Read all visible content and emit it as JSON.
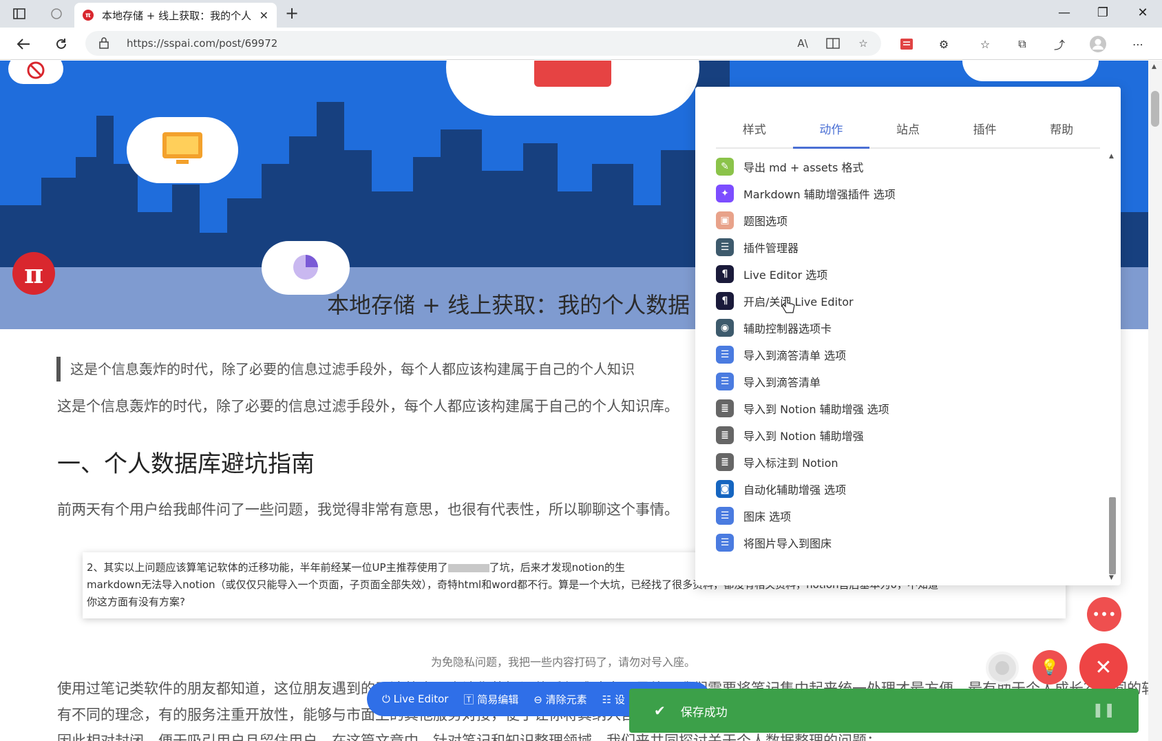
{
  "browser": {
    "tab_title": "本地存储 + 线上获取：我的个人",
    "tab_favicon": "π",
    "url": "https://sspai.com/post/69972"
  },
  "hero": {
    "title": "本地存储 + 线上获取：我的个人数据",
    "logo": "π"
  },
  "article": {
    "quote": "这是个信息轰炸的时代，除了必要的信息过滤手段外，每个人都应该构建属于自己的个人知识",
    "intro": "这是个信息轰炸的时代，除了必要的信息过滤手段外，每个人都应该构建属于自己的个人知识库。",
    "heading": "一、个人数据库避坑指南",
    "paragraph1": "前两天有个用户给我邮件问了一些问题，我觉得非常有意思，也很有代表性，所以聊聊这个事情。",
    "email_line1_a": "2、其实以上问题应该算笔记软体的迁移功能，半年前经某一位UP主推荐使用了",
    "email_line1_b": "了坑，后来才发现notion的生",
    "email_line2": "markdown无法导入notion（或仅仅只能导入一个页面，子页面全部失效），奇特html和word都不行。算是一个大坑，已经找了很多资料，都没有相关资料，notion售后基本为0，不知道",
    "email_line3": "你这方面有没有方案?",
    "caption": "为免隐私问题，我把一些内容打码了，请勿对号入座。",
    "paragraph2": "使用过笔记类软件的朋友都知道，这位朋友遇到的无法整合，会让你的知识体系很难建立，最终，我们需要将笔记集中起来统一处理才最方便，最有助于个人成长？不同的软件",
    "paragraph3": "有不同的理念，有的服务注重开放性，能够与市面上的其他服务对接，便于让你将其纳入自己的体系；有的则相对封闭。",
    "paragraph4": "因此相对封闭，便于吸引用户且留住用户。在这篇文章中，针对笔记和知识整理领域，我们来共同探讨关于个人数据整理的问题："
  },
  "popup": {
    "tabs": [
      "样式",
      "动作",
      "站点",
      "插件",
      "帮助"
    ],
    "active_tab": 1,
    "items": [
      {
        "label": "导出 md + assets 格式",
        "icon": "paperclip-icon",
        "color": "#8bc34a",
        "glyph": "✎"
      },
      {
        "label": "Markdown 辅助增强插件 选项",
        "icon": "markdown-icon",
        "color": "#7c4dff",
        "glyph": "✦"
      },
      {
        "label": "题图选项",
        "icon": "image-icon",
        "color": "#e8a28a",
        "glyph": "▣"
      },
      {
        "label": "插件管理器",
        "icon": "list-icon",
        "color": "#3d5a6c",
        "glyph": "☰"
      },
      {
        "label": "Live Editor 选项",
        "icon": "pilcrow-icon",
        "color": "#1a1a3a",
        "glyph": "¶"
      },
      {
        "label": "开启/关闭 Live Editor",
        "icon": "pilcrow-icon",
        "color": "#1a1a3a",
        "glyph": "¶"
      },
      {
        "label": "辅助控制器选项卡",
        "icon": "target-icon",
        "color": "#3d5a6c",
        "glyph": "◉"
      },
      {
        "label": "导入到滴答清单 选项",
        "icon": "checklist-icon",
        "color": "#4a7be0",
        "glyph": "☰"
      },
      {
        "label": "导入到滴答清单",
        "icon": "checklist-icon",
        "color": "#4a7be0",
        "glyph": "☰"
      },
      {
        "label": "导入到 Notion 辅助增强 选项",
        "icon": "database-icon",
        "color": "#666666",
        "glyph": "≣"
      },
      {
        "label": "导入到 Notion 辅助增强",
        "icon": "database-icon",
        "color": "#666666",
        "glyph": "≣"
      },
      {
        "label": "导入标注到 Notion",
        "icon": "database-icon",
        "color": "#666666",
        "glyph": "≣"
      },
      {
        "label": "自动化辅助增强 选项",
        "icon": "robot-icon",
        "color": "#1565c0",
        "glyph": "◙"
      },
      {
        "label": "图床 选项",
        "icon": "checklist-icon",
        "color": "#4a7be0",
        "glyph": "☰"
      },
      {
        "label": "将图片导入到图床",
        "icon": "checklist-icon",
        "color": "#4a7be0",
        "glyph": "☰"
      }
    ]
  },
  "toolbar": {
    "live_editor": "Live Editor",
    "simple_edit": "简易编辑",
    "clear_elements": "清除元素",
    "settings": "设"
  },
  "toast": {
    "message": "保存成功"
  },
  "colors": {
    "hero_blue": "#1f6ddc",
    "brand_red": "#d9272e",
    "accent_blue": "#4a6fd4",
    "toast_green": "#3ca049"
  }
}
